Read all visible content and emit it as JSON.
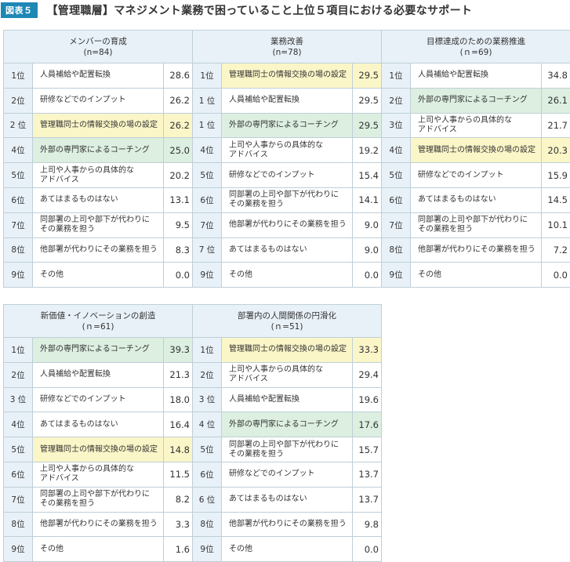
{
  "header": {
    "badge": "図表５",
    "title": "【管理職層】マネジメント業務で困っていること上位５項目における必要なサポート"
  },
  "colors": {
    "badge": "#1e88b5",
    "header_bg": "#e8f1f8",
    "highlight_yellow": "#fbf6c8",
    "highlight_green": "#dcefe0"
  },
  "chart_data": [
    {
      "type": "table",
      "title": "メンバーの育成",
      "n": "(n=84)",
      "rows": [
        {
          "rank": "1位",
          "item": "人員補給や配置転換",
          "value": "28.6",
          "hl": ""
        },
        {
          "rank": "2位",
          "item": "研修などでのインプット",
          "value": "26.2",
          "hl": ""
        },
        {
          "rank": "2 位",
          "item": "管理職同士の情報交換の場の設定",
          "value": "26.2",
          "hl": "yellow"
        },
        {
          "rank": "4位",
          "item": "外部の専門家によるコーチング",
          "value": "25.0",
          "hl": "green"
        },
        {
          "rank": "5位",
          "item": "上司や人事からの具体的な\nアドバイス",
          "value": "20.2",
          "hl": ""
        },
        {
          "rank": "6位",
          "item": "あてはまるものはない",
          "value": "13.1",
          "hl": ""
        },
        {
          "rank": "7位",
          "item": "同部署の上司や部下が代わりに\nその業務を担う",
          "value": "9.5",
          "hl": ""
        },
        {
          "rank": "8位",
          "item": "他部署が代わりにその業務を担う",
          "value": "8.3",
          "hl": ""
        },
        {
          "rank": "9位",
          "item": "その他",
          "value": "0.0",
          "hl": ""
        }
      ]
    },
    {
      "type": "table",
      "title": "業務改善",
      "n": "(n=78)",
      "rows": [
        {
          "rank": "1位",
          "item": "管理職同士の情報交換の場の設定",
          "value": "29.5",
          "hl": "yellow"
        },
        {
          "rank": "1 位",
          "item": "人員補給や配置転換",
          "value": "29.5",
          "hl": ""
        },
        {
          "rank": "1 位",
          "item": "外部の専門家によるコーチング",
          "value": "29.5",
          "hl": "green"
        },
        {
          "rank": "4位",
          "item": "上司や人事からの具体的な\nアドバイス",
          "value": "19.2",
          "hl": ""
        },
        {
          "rank": "5位",
          "item": "研修などでのインプット",
          "value": "15.4",
          "hl": ""
        },
        {
          "rank": "6位",
          "item": "同部署の上司や部下が代わりに\nその業務を担う",
          "value": "14.1",
          "hl": ""
        },
        {
          "rank": "7位",
          "item": "他部署が代わりにその業務を担う",
          "value": "9.0",
          "hl": ""
        },
        {
          "rank": "7 位",
          "item": "あてはまるものはない",
          "value": "9.0",
          "hl": ""
        },
        {
          "rank": "9位",
          "item": "その他",
          "value": "0.0",
          "hl": ""
        }
      ]
    },
    {
      "type": "table",
      "title": "目標達成のための業務推進",
      "n": "(ｎ=69)",
      "rows": [
        {
          "rank": "1位",
          "item": "人員補給や配置転換",
          "value": "34.8",
          "hl": ""
        },
        {
          "rank": "2位",
          "item": "外部の専門家によるコーチング",
          "value": "26.1",
          "hl": "green"
        },
        {
          "rank": "3位",
          "item": "上司や人事からの具体的な\nアドバイス",
          "value": "21.7",
          "hl": ""
        },
        {
          "rank": "4位",
          "item": "管理職同士の情報交換の場の設定",
          "value": "20.3",
          "hl": "yellow"
        },
        {
          "rank": "5位",
          "item": "研修などでのインプット",
          "value": "15.9",
          "hl": ""
        },
        {
          "rank": "6位",
          "item": "あてはまるものはない",
          "value": "14.5",
          "hl": ""
        },
        {
          "rank": "7位",
          "item": "同部署の上司や部下が代わりに\nその業務を担う",
          "value": "10.1",
          "hl": ""
        },
        {
          "rank": "8位",
          "item": "他部署が代わりにその業務を担う",
          "value": "7.2",
          "hl": ""
        },
        {
          "rank": "9位",
          "item": "その他",
          "value": "0.0",
          "hl": ""
        }
      ]
    },
    {
      "type": "table",
      "title": "新価値・イノベーションの創造",
      "n": "(ｎ=61)",
      "rows": [
        {
          "rank": "1位",
          "item": "外部の専門家によるコーチング",
          "value": "39.3",
          "hl": "green"
        },
        {
          "rank": "2位",
          "item": "人員補給や配置転換",
          "value": "21.3",
          "hl": ""
        },
        {
          "rank": "3 位",
          "item": "研修などでのインプット",
          "value": "18.0",
          "hl": ""
        },
        {
          "rank": "4位",
          "item": "あてはまるものはない",
          "value": "16.4",
          "hl": ""
        },
        {
          "rank": "5位",
          "item": "管理職同士の情報交換の場の設定",
          "value": "14.8",
          "hl": "yellow"
        },
        {
          "rank": "6位",
          "item": "上司や人事からの具体的な\nアドバイス",
          "value": "11.5",
          "hl": ""
        },
        {
          "rank": "7位",
          "item": "同部署の上司や部下が代わりに\nその業務を担う",
          "value": "8.2",
          "hl": ""
        },
        {
          "rank": "8位",
          "item": "他部署が代わりにその業務を担う",
          "value": "3.3",
          "hl": ""
        },
        {
          "rank": "9位",
          "item": "その他",
          "value": "1.6",
          "hl": ""
        }
      ]
    },
    {
      "type": "table",
      "title": "部署内の人間関係の円滑化",
      "n": "(ｎ=51)",
      "rows": [
        {
          "rank": "1位",
          "item": "管理職同士の情報交換の場の設定",
          "value": "33.3",
          "hl": "yellow"
        },
        {
          "rank": "2位",
          "item": "上司や人事からの具体的な\nアドバイス",
          "value": "29.4",
          "hl": ""
        },
        {
          "rank": "3 位",
          "item": "人員補給や配置転換",
          "value": "19.6",
          "hl": ""
        },
        {
          "rank": "4 位",
          "item": "外部の専門家によるコーチング",
          "value": "17.6",
          "hl": "green"
        },
        {
          "rank": "5位",
          "item": "同部署の上司や部下が代わりに\nその業務を担う",
          "value": "15.7",
          "hl": ""
        },
        {
          "rank": "6位",
          "item": "研修などでのインプット",
          "value": "13.7",
          "hl": ""
        },
        {
          "rank": "6 位",
          "item": "あてはまるものはない",
          "value": "13.7",
          "hl": ""
        },
        {
          "rank": "8位",
          "item": "他部署が代わりにその業務を担う",
          "value": "9.8",
          "hl": ""
        },
        {
          "rank": "9位",
          "item": "その他",
          "value": "0.0",
          "hl": ""
        }
      ]
    }
  ]
}
